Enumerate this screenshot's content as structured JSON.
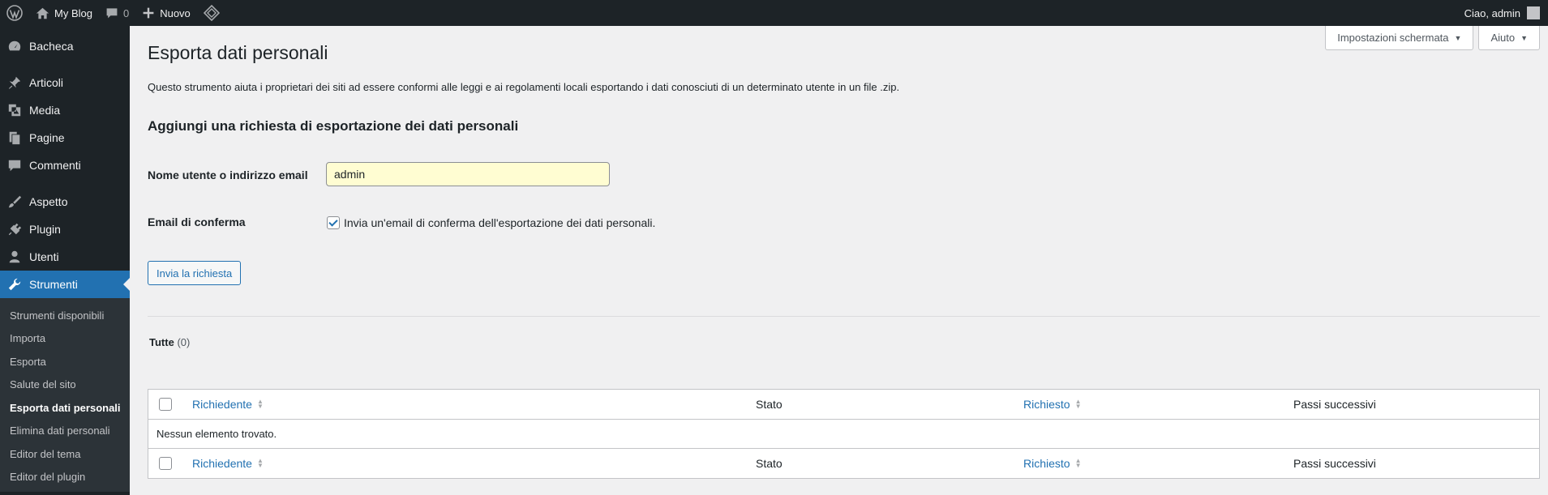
{
  "adminbar": {
    "site_name": "My Blog",
    "comments_count": "0",
    "new_label": "Nuovo",
    "greeting": "Ciao, admin"
  },
  "sidebar": {
    "items": [
      {
        "label": "Bacheca",
        "icon": "dashboard-icon"
      },
      {
        "label": "Articoli",
        "icon": "pin-icon"
      },
      {
        "label": "Media",
        "icon": "media-icon"
      },
      {
        "label": "Pagine",
        "icon": "pages-icon"
      },
      {
        "label": "Commenti",
        "icon": "comment-icon"
      },
      {
        "label": "Aspetto",
        "icon": "brush-icon"
      },
      {
        "label": "Plugin",
        "icon": "plug-icon"
      },
      {
        "label": "Utenti",
        "icon": "user-icon"
      },
      {
        "label": "Strumenti",
        "icon": "wrench-icon"
      }
    ],
    "submenu": [
      "Strumenti disponibili",
      "Importa",
      "Esporta",
      "Salute del sito",
      "Esporta dati personali",
      "Elimina dati personali",
      "Editor del tema",
      "Editor del plugin"
    ]
  },
  "screen_options": {
    "options_label": "Impostazioni schermata",
    "help_label": "Aiuto"
  },
  "page": {
    "title": "Esporta dati personali",
    "description": "Questo strumento aiuta i proprietari dei siti ad essere conformi alle leggi e ai regolamenti locali esportando i dati conosciuti di un determinato utente in un file .zip.",
    "form_heading": "Aggiungi una richiesta di esportazione dei dati personali",
    "username_label": "Nome utente o indirizzo email",
    "username_value": "admin",
    "confirm_label": "Email di conferma",
    "confirm_checkbox_text": "Invia un'email di conferma dell'esportazione dei dati personali.",
    "submit_label": "Invia la richiesta",
    "filter_label": "Tutte",
    "filter_count": "(0)"
  },
  "table": {
    "columns": {
      "requester": "Richiedente",
      "status": "Stato",
      "requested": "Richiesto",
      "next_steps": "Passi successivi"
    },
    "empty_message": "Nessun elemento trovato."
  },
  "colors": {
    "accent": "#2271b1",
    "adminbar_bg": "#1d2327",
    "input_bg": "#fffdd2"
  }
}
